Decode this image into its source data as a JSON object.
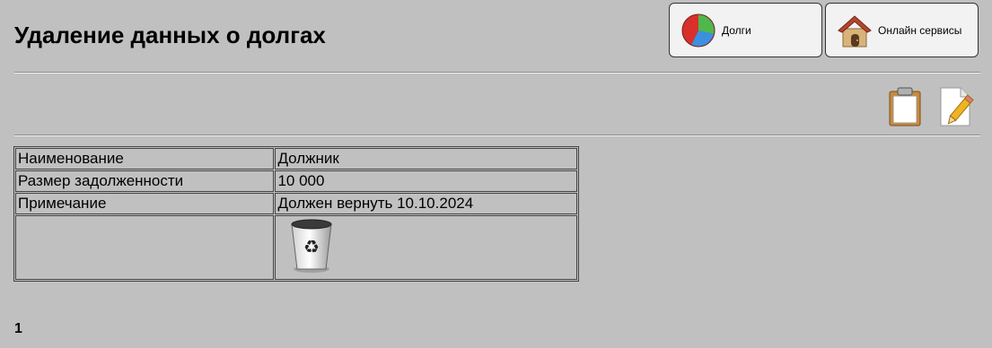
{
  "header": {
    "title": "Удаление данных о долгах"
  },
  "nav": {
    "debts_label": "Долги",
    "debts_icon": "pie-chart-icon",
    "online_label": "Онлайн сервисы",
    "online_icon": "house-icon"
  },
  "toolbar": {
    "items": [
      {
        "icon": "clipboard-icon"
      },
      {
        "icon": "edit-document-icon"
      }
    ]
  },
  "details": {
    "rows": [
      {
        "label": "Наименование",
        "value": "Должник"
      },
      {
        "label": "Размер задолженности",
        "value": "10 000"
      },
      {
        "label": "Примечание",
        "value": "Должен вернуть 10.10.2024"
      }
    ],
    "delete_icon": "recycle-bin-icon"
  },
  "pagination": {
    "current_page": "1"
  },
  "colors": {
    "background": "#c0c0c0",
    "button_bg": "#f2f2f2"
  }
}
